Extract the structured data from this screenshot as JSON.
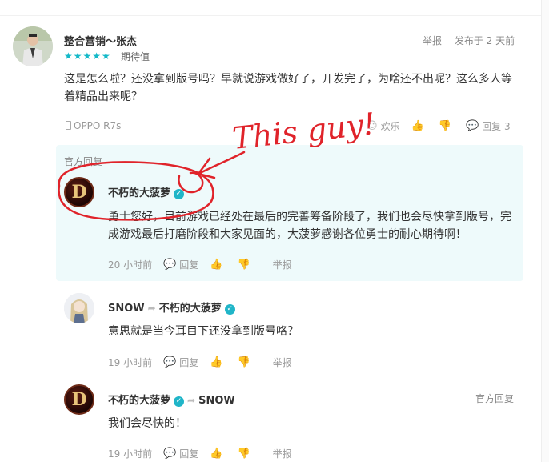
{
  "main_comment": {
    "username": "整合营销～张杰",
    "report": "举报",
    "posted": "发布于 2 天前",
    "rating_label": "期待值",
    "stars": "★★★★★",
    "text": "这是怎么啦？还没拿到版号吗？早就说游戏做好了，开发完了，为啥还不出呢？这么多人等着精品出来呢？",
    "device": "OPPO R7s",
    "reaction_label": "欢乐",
    "reply_label": "回复 3"
  },
  "official_reply": {
    "title": "官方回复",
    "username": "不朽的大菠萝",
    "text": "勇士您好，目前游戏已经处在最后的完善筹备阶段了，我们也会尽快拿到版号，完成游戏最后打磨阶段和大家见面的，大菠萝感谢各位勇士的耐心期待啊！",
    "time": "20 小时前",
    "reply": "回复",
    "report": "举报"
  },
  "sub_reply_1": {
    "username": "SNOW",
    "target": "不朽的大菠萝",
    "text": "意思就是当今耳目下还没拿到版号咯？",
    "time": "19 小时前",
    "reply": "回复",
    "report": "举报"
  },
  "sub_reply_2": {
    "username": "不朽的大菠萝",
    "target": "SNOW",
    "badge": "官方回复",
    "text": "我们会尽快的！",
    "time": "19 小时前",
    "reply": "回复",
    "report": "举报"
  },
  "annotation": {
    "text": "This guy!",
    "color": "#e0232a"
  },
  "colors": {
    "accent": "#14b9c8",
    "reply_bg": "#eefafb"
  },
  "logo_letter": "D"
}
